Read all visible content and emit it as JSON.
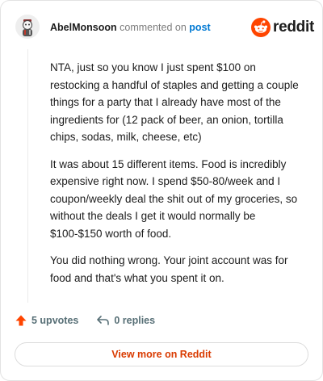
{
  "header": {
    "username": "AbelMonsoon",
    "action": "commented on",
    "link_text": "post",
    "brand": "reddit"
  },
  "comment": {
    "paragraphs": [
      "NTA, just so you know I just spent $100 on restocking a handful of staples and getting a couple things for a party that I already have most of the ingredients for (12 pack of beer, an onion, tortilla chips, sodas, milk, cheese, etc)",
      "It was about 15 different items. Food is incredibly expensive right now. I spend $50-80/week and I coupon/weekly deal the shit out of my groceries, so without the deals I get it would normally be $100-$150 worth of food.",
      "You did nothing wrong. Your joint account was for food and that's what you spent it on."
    ]
  },
  "footer": {
    "upvotes": "5 upvotes",
    "replies": "0 replies",
    "view_more": "View more on Reddit"
  },
  "icons": {
    "upvote": "upvote-arrow-icon",
    "reply": "reply-arrow-icon",
    "brand": "reddit-snoo-icon"
  },
  "colors": {
    "brand_orange": "#ff4500",
    "link_blue": "#0079d3",
    "view_more_text": "#d93a00",
    "meta_gray": "#576f76"
  }
}
